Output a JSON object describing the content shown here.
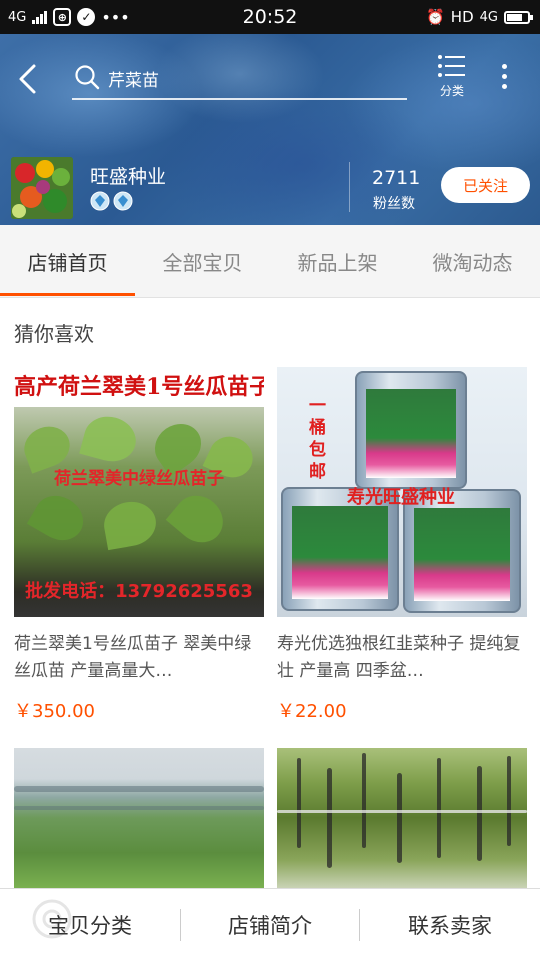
{
  "status_bar": {
    "network_left": "4G",
    "time": "20:52",
    "hd_label": "HD",
    "network_right": "4G"
  },
  "header": {
    "search_text": "芹菜苗",
    "category_label": "分类",
    "shop_name": "旺盛种业",
    "fans_count": "2711",
    "fans_label": "粉丝数",
    "follow_label": "已关注"
  },
  "tabs": [
    {
      "label": "店铺首页",
      "active": true
    },
    {
      "label": "全部宝贝",
      "active": false
    },
    {
      "label": "新品上架",
      "active": false
    },
    {
      "label": "微淘动态",
      "active": false
    }
  ],
  "section_title": "猜你喜欢",
  "products": [
    {
      "image_title": "高产荷兰翠美1号丝瓜苗子",
      "image_sub": "荷兰翠美中绿丝瓜苗子",
      "image_phone": "批发电话：13792625563",
      "title": "荷兰翠美1号丝瓜苗子 翠美中绿丝瓜苗 产量高量大…",
      "price": "￥350.00"
    },
    {
      "image_side_text": "一桶包邮",
      "image_brand": "寿光旺盛种业",
      "title": "寿光优选独根红韭菜种子 提纯复壮 产量高 四季盆…",
      "price": "￥22.00"
    },
    {
      "title": "",
      "price": ""
    },
    {
      "title": "",
      "price": ""
    }
  ],
  "bottom_bar": {
    "item1": "宝贝分类",
    "item2": "店铺简介",
    "item3": "联系卖家"
  },
  "colors": {
    "accent": "#ff5000",
    "header_blue": "#2b5a93"
  }
}
